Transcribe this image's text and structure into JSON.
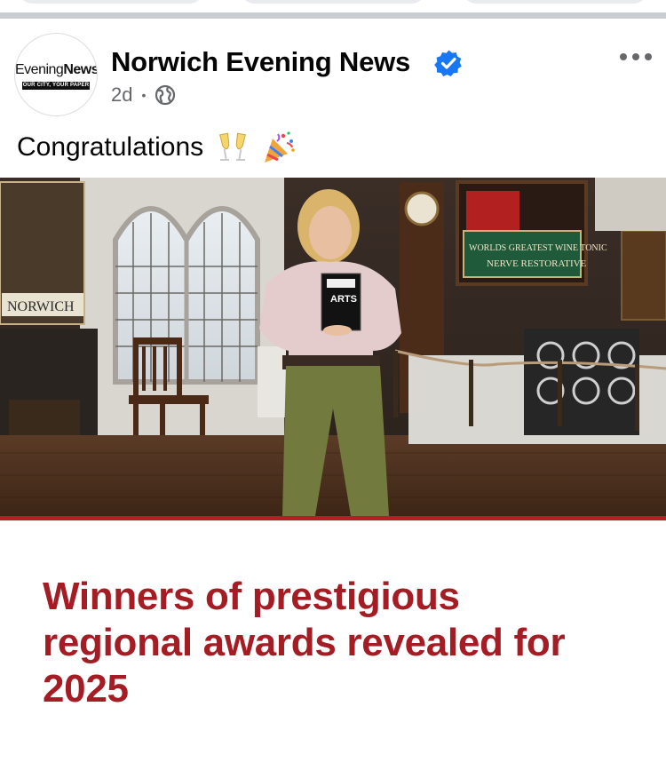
{
  "post": {
    "page_name": "Norwich Evening News",
    "time_ago": "2d",
    "separator": "•",
    "caption": "Congratulations",
    "caption_emojis": [
      "clinking-glasses-emoji",
      "party-popper-emoji"
    ]
  },
  "avatar": {
    "logo_word_1": "Evening",
    "logo_word_2": "News",
    "logo_tagline": "OUR CITY, YOUR PAPER"
  },
  "photo": {
    "sign_left": "NORWICH",
    "sign_right_line1": "WORLDS GREATEST WINE TONIC",
    "sign_right_line2": "NERVE RESTORATIVE",
    "trophy_text": "ARTS"
  },
  "link_card": {
    "headline": "Winners of prestigious regional awards revealed for 2025"
  },
  "colors": {
    "brand_blue": "#1877f2",
    "headline_red": "#a51d24",
    "secondary_text": "#65676b"
  }
}
